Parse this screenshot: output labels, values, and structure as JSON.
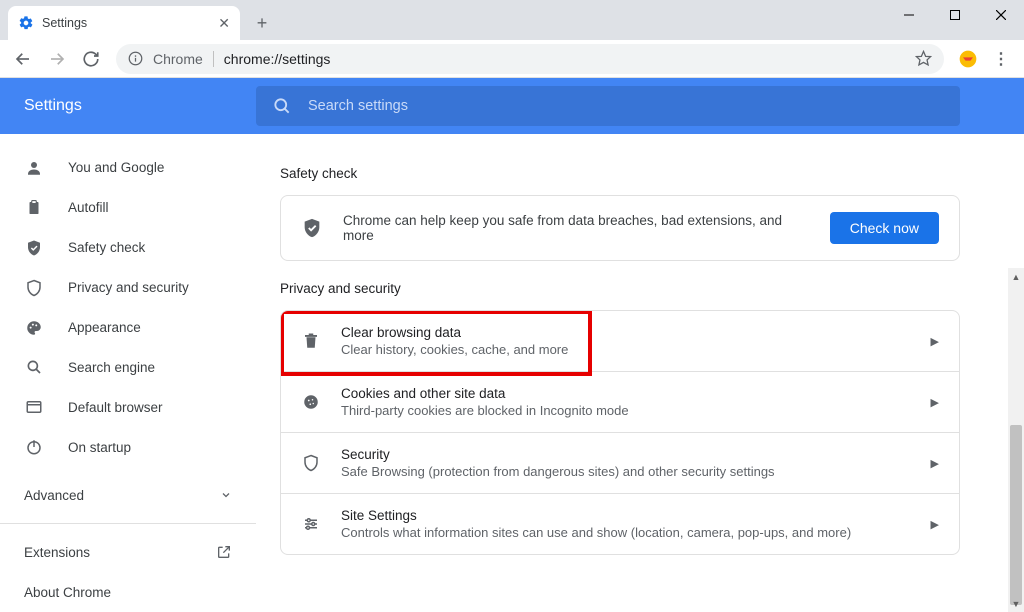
{
  "window": {
    "tab_title": "Settings",
    "new_tab_glyph": "+"
  },
  "toolbar": {
    "chrome_label": "Chrome",
    "url": "chrome://settings",
    "menu_glyph": "⋮"
  },
  "header": {
    "title": "Settings",
    "search_placeholder": "Search settings"
  },
  "sidebar": {
    "items": [
      {
        "label": "You and Google"
      },
      {
        "label": "Autofill"
      },
      {
        "label": "Safety check"
      },
      {
        "label": "Privacy and security"
      },
      {
        "label": "Appearance"
      },
      {
        "label": "Search engine"
      },
      {
        "label": "Default browser"
      },
      {
        "label": "On startup"
      }
    ],
    "advanced_label": "Advanced",
    "extensions_label": "Extensions",
    "about_label": "About Chrome"
  },
  "safety": {
    "section_title": "Safety check",
    "text": "Chrome can help keep you safe from data breaches, bad extensions, and more",
    "button": "Check now"
  },
  "privacy": {
    "section_title": "Privacy and security",
    "rows": [
      {
        "title": "Clear browsing data",
        "desc": "Clear history, cookies, cache, and more"
      },
      {
        "title": "Cookies and other site data",
        "desc": "Third-party cookies are blocked in Incognito mode"
      },
      {
        "title": "Security",
        "desc": "Safe Browsing (protection from dangerous sites) and other security settings"
      },
      {
        "title": "Site Settings",
        "desc": "Controls what information sites can use and show (location, camera, pop-ups, and more)"
      }
    ]
  }
}
